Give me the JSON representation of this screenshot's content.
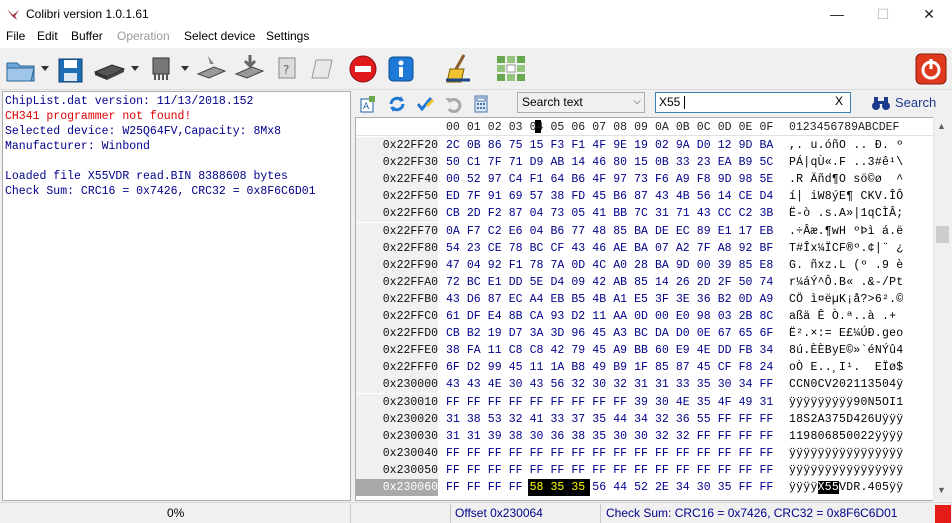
{
  "window": {
    "title": "Colibri version 1.0.1.61",
    "minimize": "—",
    "maximize": "☐",
    "close": "✕"
  },
  "menu": [
    "File",
    "Edit",
    "Buffer",
    "Operation",
    "Select device",
    "Settings"
  ],
  "menu_disabled": [
    "Operation"
  ],
  "toolbar": {
    "icons": [
      "open-folder-icon",
      "save-icon",
      "chip-read-icon",
      "chip-device-icon",
      "chip-erase-icon",
      "chip-write-icon",
      "chip-verify-icon",
      "blank-check-icon",
      "stop-icon",
      "info-icon",
      "clean-broom-icon",
      "grid-select-icon",
      "power-exit-icon"
    ]
  },
  "log": [
    {
      "text": "ChipList.dat version: 11/13/2018.152",
      "type": "info"
    },
    {
      "text": "CH341 programmer not found!",
      "type": "error"
    },
    {
      "text": "Selected device: W25Q64FV,Capacity: 8Mx8",
      "type": "info"
    },
    {
      "text": "Manufacturer: Winbond",
      "type": "info"
    },
    {
      "text": "",
      "type": "info"
    },
    {
      "text": "Loaded file X55VDR read.BIN 8388608 bytes",
      "type": "info"
    },
    {
      "text": "Check Sum: CRC16 = 0x7426, CRC32 = 0x8F6C6D01",
      "type": "info"
    }
  ],
  "search": {
    "type_selected": "Search text",
    "value": "X55",
    "clear_label": "X",
    "button_label": "Search"
  },
  "hex": {
    "header_cols": [
      "00",
      "01",
      "02",
      "03",
      "04",
      "05",
      "06",
      "07",
      "08",
      "09",
      "0A",
      "0B",
      "0C",
      "0D",
      "0E",
      "0F"
    ],
    "ascii_header": "0123456789ABCDEF",
    "rows": [
      {
        "addr": "0x22FF20",
        "bytes": [
          "2C",
          "0B",
          "86",
          "75",
          "15",
          "F3",
          "F1",
          "4F",
          "9E",
          "19",
          "02",
          "9A",
          "D0",
          "12",
          "9D",
          "BA"
        ],
        "ascii": ",. u.óñO .. Ð. º"
      },
      {
        "addr": "0x22FF30",
        "bytes": [
          "50",
          "C1",
          "7F",
          "71",
          "D9",
          "AB",
          "14",
          "46",
          "80",
          "15",
          "0B",
          "33",
          "23",
          "EA",
          "B9",
          "5C"
        ],
        "ascii": "PÁ|qÙ«.F ..3#ê¹\\"
      },
      {
        "addr": "0x22FF40",
        "bytes": [
          "00",
          "52",
          "97",
          "C4",
          "F1",
          "64",
          "B6",
          "4F",
          "97",
          "73",
          "F6",
          "A9",
          "F8",
          "9D",
          "98",
          "5E"
        ],
        "ascii": ".R Äñd¶O sö©ø  ^"
      },
      {
        "addr": "0x22FF50",
        "bytes": [
          "ED",
          "7F",
          "91",
          "69",
          "57",
          "38",
          "FD",
          "45",
          "B6",
          "87",
          "43",
          "4B",
          "56",
          "14",
          "CE",
          "D4"
        ],
        "ascii": "í| iW8ýE¶ CKV.ÎÔ"
      },
      {
        "addr": "0x22FF60",
        "bytes": [
          "CB",
          "2D",
          "F2",
          "87",
          "04",
          "73",
          "05",
          "41",
          "BB",
          "7C",
          "31",
          "71",
          "43",
          "CC",
          "C2",
          "3B"
        ],
        "ascii": "Ë-ò .s.A»|1qCÌÂ;"
      },
      {
        "addr": "0x22FF70",
        "bytes": [
          "0A",
          "F7",
          "C2",
          "E6",
          "04",
          "B6",
          "77",
          "48",
          "85",
          "BA",
          "DE",
          "EC",
          "89",
          "E1",
          "17",
          "EB"
        ],
        "ascii": ".÷Âæ.¶wH ºÞì á.ë"
      },
      {
        "addr": "0x22FF80",
        "bytes": [
          "54",
          "23",
          "CE",
          "78",
          "BC",
          "CF",
          "43",
          "46",
          "AE",
          "BA",
          "07",
          "A2",
          "7F",
          "A8",
          "92",
          "BF"
        ],
        "ascii": "T#Îx¼ÏCF®º.¢|¨ ¿"
      },
      {
        "addr": "0x22FF90",
        "bytes": [
          "47",
          "04",
          "92",
          "F1",
          "78",
          "7A",
          "0D",
          "4C",
          "A0",
          "28",
          "BA",
          "9D",
          "00",
          "39",
          "85",
          "E8"
        ],
        "ascii": "G. ñxz.L (º .9 è"
      },
      {
        "addr": "0x22FFA0",
        "bytes": [
          "72",
          "BC",
          "E1",
          "DD",
          "5E",
          "D4",
          "09",
          "42",
          "AB",
          "85",
          "14",
          "26",
          "2D",
          "2F",
          "50",
          "74"
        ],
        "ascii": "r¼áÝ^Ô.B« .&-/Pt"
      },
      {
        "addr": "0x22FFB0",
        "bytes": [
          "43",
          "D6",
          "87",
          "EC",
          "A4",
          "EB",
          "B5",
          "4B",
          "A1",
          "E5",
          "3F",
          "3E",
          "36",
          "B2",
          "0D",
          "A9"
        ],
        "ascii": "CÖ ì¤ëµK¡å?>6².©"
      },
      {
        "addr": "0x22FFC0",
        "bytes": [
          "61",
          "DF",
          "E4",
          "8B",
          "CA",
          "93",
          "D2",
          "11",
          "AA",
          "0D",
          "00",
          "E0",
          "98",
          "03",
          "2B",
          "8C"
        ],
        "ascii": "aßä Ê Ò.ª..à .+ "
      },
      {
        "addr": "0x22FFD0",
        "bytes": [
          "CB",
          "B2",
          "19",
          "D7",
          "3A",
          "3D",
          "96",
          "45",
          "A3",
          "BC",
          "DA",
          "D0",
          "0E",
          "67",
          "65",
          "6F"
        ],
        "ascii": "Ë².×:= E£¼ÚÐ.geo"
      },
      {
        "addr": "0x22FFE0",
        "bytes": [
          "38",
          "FA",
          "11",
          "C8",
          "C8",
          "42",
          "79",
          "45",
          "A9",
          "BB",
          "60",
          "E9",
          "4E",
          "DD",
          "FB",
          "34"
        ],
        "ascii": "8ú.ÈÈByE©»`éNÝû4"
      },
      {
        "addr": "0x22FFF0",
        "bytes": [
          "6F",
          "D2",
          "99",
          "45",
          "11",
          "1A",
          "B8",
          "49",
          "B9",
          "1F",
          "85",
          "87",
          "45",
          "CF",
          "F8",
          "24"
        ],
        "ascii": "oÒ E..¸I¹.  EÏø$"
      },
      {
        "addr": "0x230000",
        "bytes": [
          "43",
          "43",
          "4E",
          "30",
          "43",
          "56",
          "32",
          "30",
          "32",
          "31",
          "31",
          "33",
          "35",
          "30",
          "34",
          "FF"
        ],
        "ascii": "CCN0CV202113504ÿ"
      },
      {
        "addr": "0x230010",
        "bytes": [
          "FF",
          "FF",
          "FF",
          "FF",
          "FF",
          "FF",
          "FF",
          "FF",
          "FF",
          "39",
          "30",
          "4E",
          "35",
          "4F",
          "49",
          "31"
        ],
        "ascii": "ÿÿÿÿÿÿÿÿÿ90N5OI1"
      },
      {
        "addr": "0x230020",
        "bytes": [
          "31",
          "38",
          "53",
          "32",
          "41",
          "33",
          "37",
          "35",
          "44",
          "34",
          "32",
          "36",
          "55",
          "FF",
          "FF",
          "FF"
        ],
        "ascii": "18S2A375D426Uÿÿÿ"
      },
      {
        "addr": "0x230030",
        "bytes": [
          "31",
          "31",
          "39",
          "38",
          "30",
          "36",
          "38",
          "35",
          "30",
          "30",
          "32",
          "32",
          "FF",
          "FF",
          "FF",
          "FF"
        ],
        "ascii": "119806850022ÿÿÿÿ"
      },
      {
        "addr": "0x230040",
        "bytes": [
          "FF",
          "FF",
          "FF",
          "FF",
          "FF",
          "FF",
          "FF",
          "FF",
          "FF",
          "FF",
          "FF",
          "FF",
          "FF",
          "FF",
          "FF",
          "FF"
        ],
        "ascii": "ÿÿÿÿÿÿÿÿÿÿÿÿÿÿÿÿ"
      },
      {
        "addr": "0x230050",
        "bytes": [
          "FF",
          "FF",
          "FF",
          "FF",
          "FF",
          "FF",
          "FF",
          "FF",
          "FF",
          "FF",
          "FF",
          "FF",
          "FF",
          "FF",
          "FF",
          "FF"
        ],
        "ascii": "ÿÿÿÿÿÿÿÿÿÿÿÿÿÿÿÿ"
      },
      {
        "addr": "0x230060",
        "bytes": [
          "FF",
          "FF",
          "FF",
          "FF",
          "58",
          "35",
          "35",
          "56",
          "44",
          "52",
          "2E",
          "34",
          "30",
          "35",
          "FF",
          "FF"
        ],
        "ascii": "ÿÿÿÿX55VDR.405ÿÿ",
        "selected": true,
        "highlight": [
          4,
          5,
          6
        ]
      }
    ]
  },
  "status": {
    "progress": "0%",
    "offset": "Offset 0x230064",
    "checksum": "Check Sum: CRC16 = 0x7426, CRC32 = 0x8F6C6D01"
  },
  "colors": {
    "log_text": "#00008b",
    "log_error": "#e00000",
    "highlight_bg": "#000000",
    "highlight_fg": "#ffff00"
  }
}
